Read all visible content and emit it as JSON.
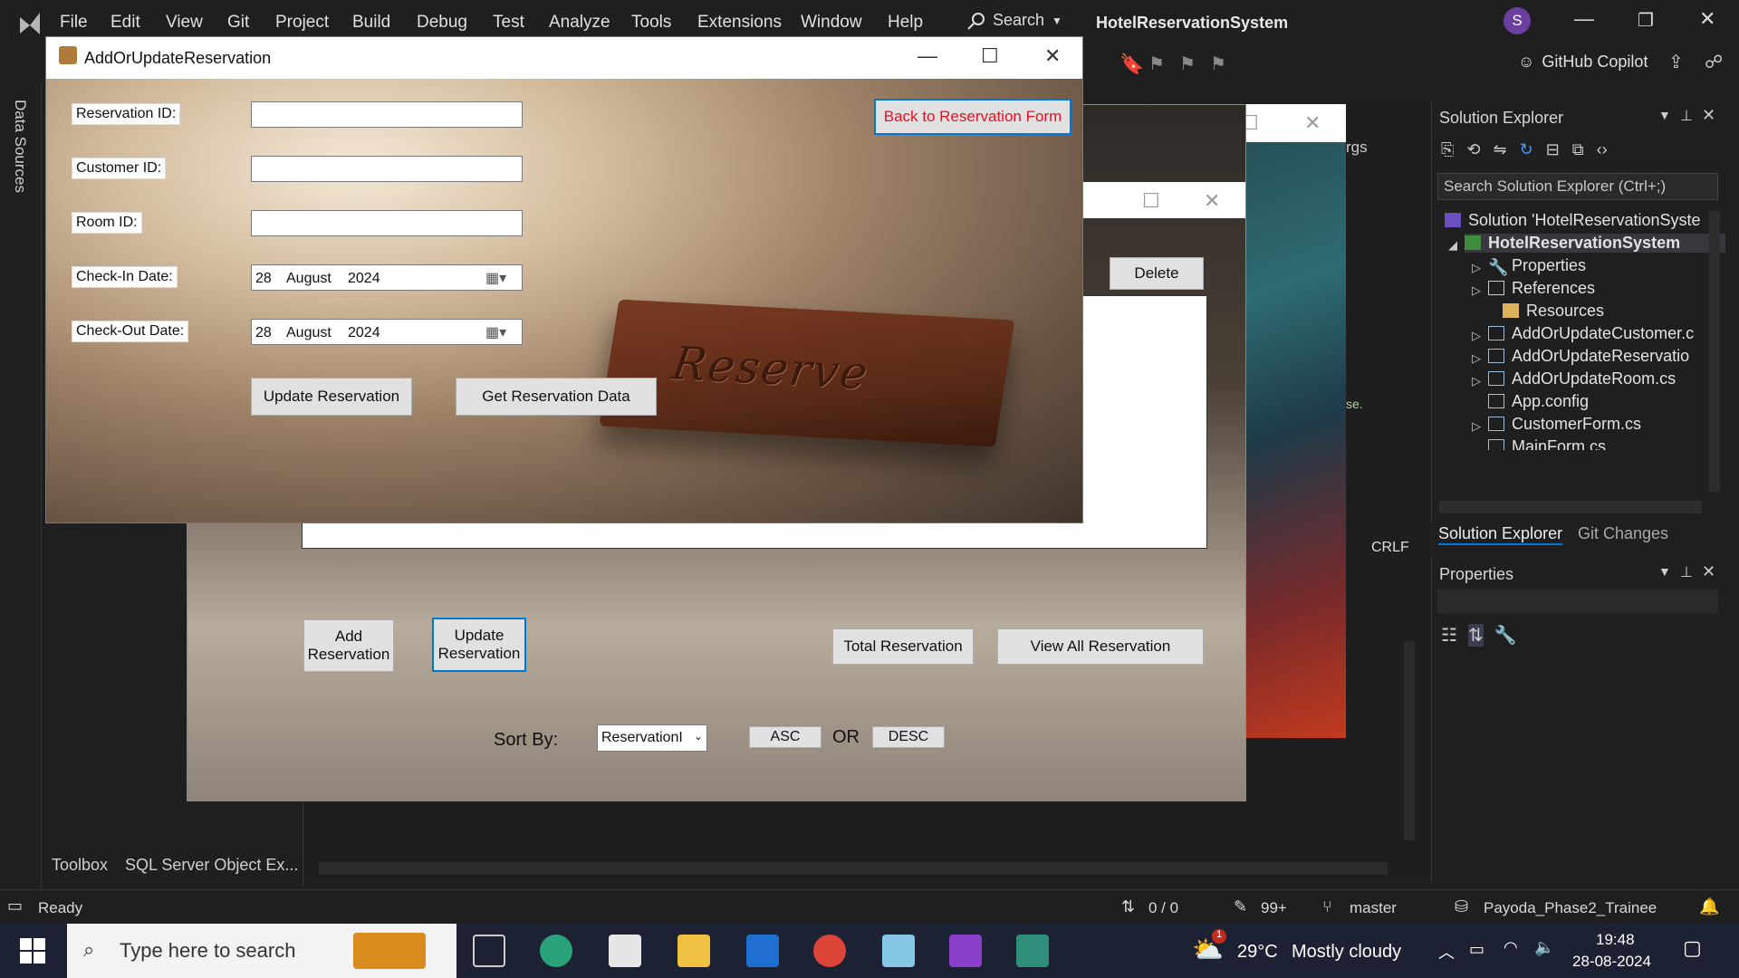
{
  "vs": {
    "menu": [
      "File",
      "Edit",
      "View",
      "Git",
      "Project",
      "Build",
      "Debug",
      "Test",
      "Analyze",
      "Tools",
      "Extensions",
      "Window",
      "Help"
    ],
    "search_label": "Search",
    "solution_title": "HotelReservationSystem",
    "avatar_letter": "S",
    "copilot_label": "GitHub Copilot",
    "left_tab": "Data Sources",
    "bottom_tabs": [
      "Toolbox",
      "SQL Server Object Ex..."
    ],
    "editor_crlf": "CRLF",
    "editor_args": "rgs",
    "editor_fragment": "se."
  },
  "solution_explorer": {
    "title": "Solution Explorer",
    "search_placeholder": "Search Solution Explorer (Ctrl+;)",
    "items": [
      {
        "label": "Solution 'HotelReservationSyste"
      },
      {
        "label": "HotelReservationSystem"
      },
      {
        "label": "Properties"
      },
      {
        "label": "References"
      },
      {
        "label": "Resources"
      },
      {
        "label": "AddOrUpdateCustomer.c"
      },
      {
        "label": "AddOrUpdateReservatio"
      },
      {
        "label": "AddOrUpdateRoom.cs"
      },
      {
        "label": "App.config"
      },
      {
        "label": "CustomerForm.cs"
      },
      {
        "label": "MainForm.cs"
      }
    ],
    "tabs": [
      "Solution Explorer",
      "Git Changes"
    ]
  },
  "properties": {
    "title": "Properties"
  },
  "status_bar": {
    "ready": "Ready",
    "lines": "0 / 0",
    "edits": "99+",
    "branch": "master",
    "repo": "Payoda_Phase2_Trainee"
  },
  "taskbar": {
    "search_placeholder": "Type here to search",
    "weather_temp": "29°C",
    "weather_desc": "Mostly cloudy",
    "weather_badge": "1",
    "time": "19:48",
    "date": "28-08-2024"
  },
  "main_form": {
    "delete_label": "Delete",
    "add_label": "Add Reservation",
    "update_label": "Update Reservation",
    "total_label": "Total Reservation",
    "view_all_label": "View All Reservation",
    "sort_by_label": "Sort By:",
    "sort_value": "ReservationI",
    "asc_label": "ASC",
    "or_label": "OR",
    "desc_label": "DESC"
  },
  "dialog": {
    "title": "AddOrUpdateReservation",
    "back_label": "Back to Reservation Form",
    "reservation_id_label": "Reservation ID:",
    "customer_id_label": "Customer ID:",
    "room_id_label": "Room ID:",
    "check_in_label": "Check-In Date:",
    "check_out_label": "Check-Out Date:",
    "check_in": {
      "day": "28",
      "month": "August",
      "year": "2024"
    },
    "check_out": {
      "day": "28",
      "month": "August",
      "year": "2024"
    },
    "update_label": "Update Reservation",
    "get_label": "Get Reservation Data",
    "sign_text": "Reserve"
  },
  "colors": {
    "vs_bg": "#1f1f1f",
    "accent": "#0078d7",
    "back_button_text": "#e81123"
  }
}
